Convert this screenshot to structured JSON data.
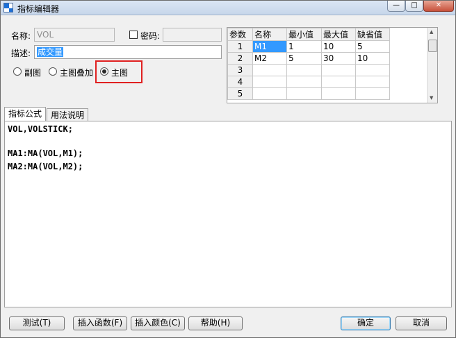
{
  "window": {
    "title": "指标编辑器",
    "controls": {
      "minimize": "—",
      "maximize": "□",
      "close": "✕"
    }
  },
  "form": {
    "name_label": "名称:",
    "name_value": "VOL",
    "password_label": "密码:",
    "password_value": "",
    "password_checked": false,
    "desc_label": "描述:",
    "desc_value": "成交量",
    "chart_types": [
      {
        "label": "副图",
        "checked": false
      },
      {
        "label": "主图叠加",
        "checked": false
      },
      {
        "label": "主图",
        "checked": true
      }
    ]
  },
  "params": {
    "headers": [
      "参数",
      "名称",
      "最小值",
      "最大值",
      "缺省值"
    ],
    "rows": [
      {
        "no": "1",
        "name": "M1",
        "min": "1",
        "max": "10",
        "default": "5"
      },
      {
        "no": "2",
        "name": "M2",
        "min": "5",
        "max": "30",
        "default": "10"
      },
      {
        "no": "3",
        "name": "",
        "min": "",
        "max": "",
        "default": ""
      },
      {
        "no": "4",
        "name": "",
        "min": "",
        "max": "",
        "default": ""
      },
      {
        "no": "5",
        "name": "",
        "min": "",
        "max": "",
        "default": ""
      }
    ]
  },
  "tabs": [
    {
      "label": "指标公式",
      "active": true
    },
    {
      "label": "用法说明",
      "active": false
    }
  ],
  "editor": {
    "lines": [
      "VOL,VOLSTICK;",
      "",
      "MA1:MA(VOL,M1);",
      "MA2:MA(VOL,M2);"
    ]
  },
  "buttons": {
    "test": "测试(T)",
    "insert_function": "插入函数(F)",
    "insert_color": "插入颜色(C)",
    "help": "帮助(H)",
    "ok": "确定",
    "cancel": "取消"
  }
}
